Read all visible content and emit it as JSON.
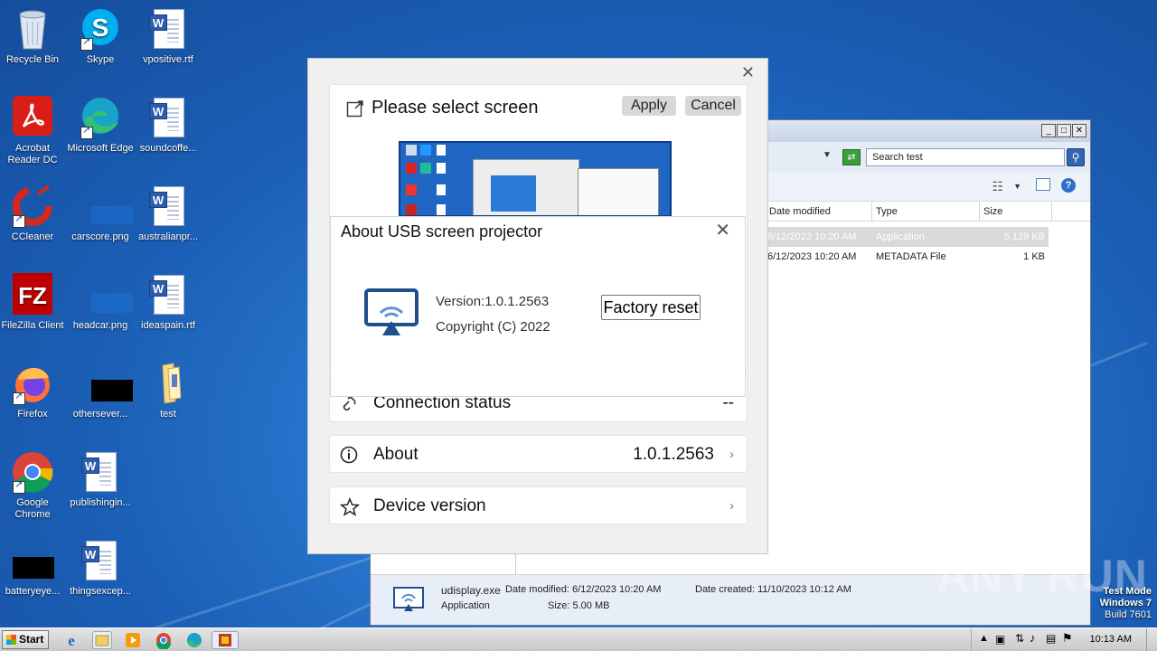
{
  "desktop": {
    "icons": [
      {
        "label": "Recycle Bin"
      },
      {
        "label": "Skype"
      },
      {
        "label": "vpositive.rtf"
      },
      {
        "label": "Acrobat Reader DC"
      },
      {
        "label": "Microsoft Edge"
      },
      {
        "label": "soundcoffe..."
      },
      {
        "label": "CCleaner"
      },
      {
        "label": "carscore.png"
      },
      {
        "label": "australianpr..."
      },
      {
        "label": "FileZilla Client"
      },
      {
        "label": "headcar.png"
      },
      {
        "label": "ideaspain.rtf"
      },
      {
        "label": "Firefox"
      },
      {
        "label": "othersever..."
      },
      {
        "label": "test"
      },
      {
        "label": "Google Chrome"
      },
      {
        "label": "publishingin..."
      },
      {
        "label": "batteryeye..."
      },
      {
        "label": "thingsexcep..."
      }
    ]
  },
  "explorer": {
    "search_placeholder": "Search test",
    "columns": [
      "Date modified",
      "Type",
      "Size"
    ],
    "files": [
      {
        "date": "6/12/2023 10:20 AM",
        "type": "Application",
        "size": "5,129 KB"
      },
      {
        "date": "6/12/2023 10:20 AM",
        "type": "METADATA File",
        "size": "1 KB"
      }
    ],
    "details": {
      "name": "udisplay.exe",
      "type": "Application",
      "modified": "Date modified: 6/12/2023 10:20 AM",
      "created": "Date created: 11/10/2023 10:12 AM",
      "size": "Size: 5.00 MB"
    }
  },
  "dialog": {
    "select_title": "Please select screen",
    "apply_label": "Apply",
    "cancel_label": "Cancel",
    "connection_label": "Connection status",
    "connection_value": "--",
    "about_label": "About",
    "about_value": "1.0.1.2563",
    "device_label": "Device version"
  },
  "about_dialog": {
    "title": "About USB screen projector",
    "version": "Version:1.0.1.2563",
    "copyright": "Copyright (C) 2022",
    "factory_reset": "Factory reset"
  },
  "taskbar": {
    "start_label": "Start",
    "clock": "10:13 AM"
  },
  "overlay": {
    "watermark": "ANY RUN",
    "test_mode": "Test Mode",
    "os": "Windows 7",
    "build": "Build 7601"
  }
}
